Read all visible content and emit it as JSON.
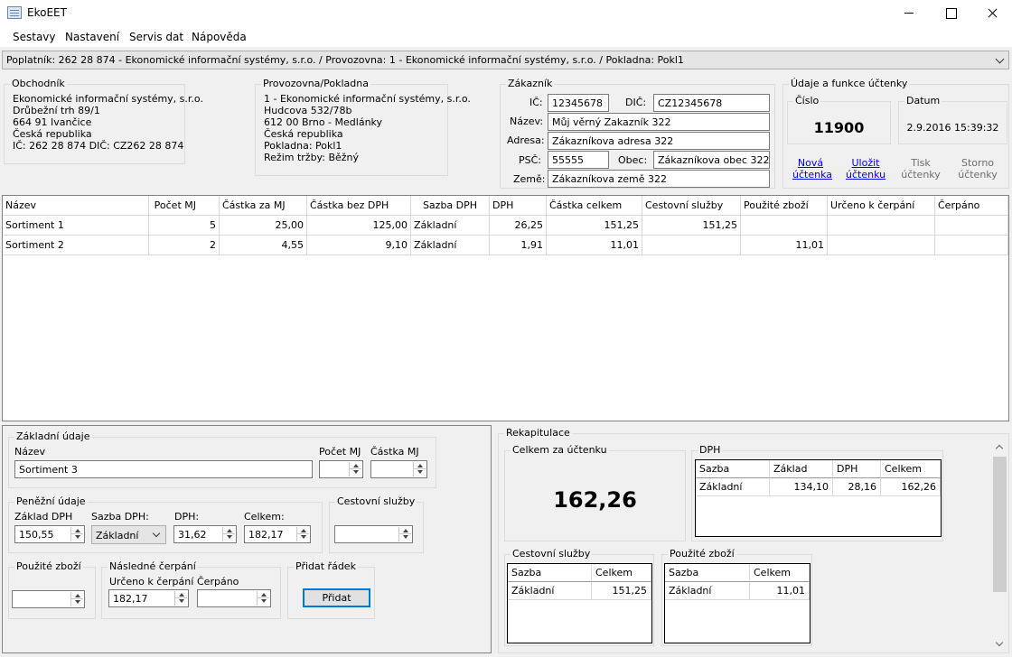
{
  "window": {
    "title": "EkoEET"
  },
  "menu": [
    "Sestavy",
    "Nastavení",
    "Servis dat",
    "Nápověda"
  ],
  "selector": {
    "value": "Poplatník: 262 28 874 - Ekonomické informační systémy, s.r.o. / Provozovna: 1 - Ekonomické informační systémy, s.r.o. / Pokladna: Pokl1"
  },
  "obchodnik": {
    "label": "Obchodník",
    "lines": [
      "Ekonomické informační systémy, s.r.o.",
      "Drůbežní trh 89/1",
      "664 91 Ivančice",
      "Česká republika",
      "IČ: 262 28 874 DIČ: CZ262 28 874"
    ]
  },
  "provozovna": {
    "label": "Provozovna/Pokladna",
    "lines": [
      "1 - Ekonomické informační systémy, s.r.o.",
      "Hudcova 532/78b",
      "612 00 Brno - Medlánky",
      "Česká republika",
      "Pokladna: Pokl1",
      "Režim tržby: Běžný"
    ]
  },
  "zakaznik": {
    "label": "Zákazník",
    "ic_label": "IČ:",
    "ic": "12345678",
    "dic_label": "DIČ:",
    "dic": "CZ12345678",
    "nazev_label": "Název:",
    "nazev": "Můj věrný Zakazník 322",
    "adresa_label": "Adresa:",
    "adresa": "Zákazníkova adresa 322",
    "psc_label": "PSČ:",
    "psc": "55555",
    "obec_label": "Obec:",
    "obec": "Zákazníkova obec 322",
    "zeme_label": "Země:",
    "zeme": "Zákazníkova země 322"
  },
  "uctenka": {
    "label": "Údaje a funkce účtenky",
    "cislo_label": "Číslo",
    "cislo": "11900",
    "datum_label": "Datum",
    "datum": "2.9.2016 15:39:32",
    "actions": [
      {
        "line1": "Nová",
        "line2": "účtenka",
        "enabled": true
      },
      {
        "line1": "Uložit",
        "line2": "účtenku",
        "enabled": true
      },
      {
        "line1": "Tisk",
        "line2": "účtenky",
        "enabled": false
      },
      {
        "line1": "Storno",
        "line2": "účtenky",
        "enabled": false
      }
    ]
  },
  "grid": {
    "columns": [
      "Název",
      "Počet MJ",
      "Částka za MJ",
      "Částka bez DPH",
      "Sazba DPH",
      "DPH",
      "Částka celkem",
      "Cestovní služby",
      "Použité zboží",
      "Určeno k čerpání",
      "Čerpáno"
    ],
    "rows": [
      [
        "Sortiment 1",
        "5",
        "25,00",
        "125,00",
        "Základní",
        "26,25",
        "151,25",
        "151,25",
        "",
        "",
        ""
      ],
      [
        "Sortiment 2",
        "2",
        "4,55",
        "9,10",
        "Základní",
        "1,91",
        "11,01",
        "",
        "11,01",
        "",
        ""
      ]
    ]
  },
  "zakladni": {
    "label": "Základní údaje",
    "nazev_label": "Název",
    "nazev": "Sortiment 3",
    "pocet_label": "Počet MJ",
    "pocet": "",
    "castka_label": "Částka MJ",
    "castka": ""
  },
  "penezni": {
    "label": "Peněžní údaje",
    "zaklad_label": "Základ DPH",
    "zaklad": "150,55",
    "sazba_label": "Sazba DPH:",
    "sazba": "Základní",
    "dph_label": "DPH:",
    "dph": "31,62",
    "celkem_label": "Celkem:",
    "celkem": "182,17"
  },
  "cestovni": {
    "label": "Cestovní služby",
    "value": ""
  },
  "pouzite": {
    "label": "Použité zboží",
    "value": ""
  },
  "nasledne": {
    "label": "Následné čerpání",
    "urceno_label": "Určeno k čerpání",
    "urceno": "182,17",
    "cerpano_label": "Čerpáno",
    "cerpano": ""
  },
  "pridat": {
    "label": "Přidat řádek",
    "button": "Přidat"
  },
  "rekapitulace": {
    "label": "Rekapitulace",
    "celkem_label": "Celkem za účtenku",
    "celkem": "162,26",
    "dph": {
      "label": "DPH",
      "columns": [
        "Sazba",
        "Základ",
        "DPH",
        "Celkem"
      ],
      "rows": [
        [
          "Základní",
          "134,10",
          "28,16",
          "162,26"
        ]
      ]
    },
    "cestovni": {
      "label": "Cestovní služby",
      "columns": [
        "Sazba",
        "Celkem"
      ],
      "rows": [
        [
          "Základní",
          "151,25"
        ]
      ]
    },
    "pouzite": {
      "label": "Použité zboží",
      "columns": [
        "Sazba",
        "Celkem"
      ],
      "rows": [
        [
          "Základní",
          "11,01"
        ]
      ]
    }
  }
}
